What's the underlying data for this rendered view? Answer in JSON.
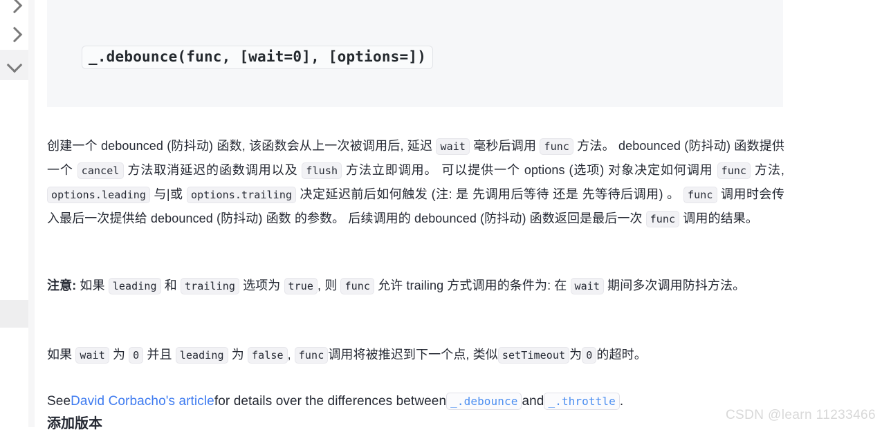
{
  "rail": {
    "items": [
      {
        "name": "chevron-right-icon",
        "glyph": "right",
        "active": false
      },
      {
        "name": "chevron-right-icon",
        "glyph": "right",
        "active": false
      },
      {
        "name": "chevron-down-icon",
        "glyph": "down",
        "active": true
      }
    ]
  },
  "code_block": {
    "signature": "_.debounce(func, [wait=0], [options=])"
  },
  "paragraphs": {
    "p1": {
      "t1": "创建一个 debounced (防抖动) 函数, 该函数会从上一次被调用后, 延迟 ",
      "c1": "wait",
      "t2": " 毫秒后调用 ",
      "c2": "func",
      "t3": " 方法。 debounced (防抖动) 函数提供一个 ",
      "c3": "cancel",
      "t4": " 方法取消延迟的函数调用以及 ",
      "c4": "flush",
      "t5": " 方法立即调用。 可以提供一个 options (选项) 对象决定如何调用 ",
      "c5": "func",
      "t6": " 方法, ",
      "c6": "options.leading",
      "t7": " 与|或 ",
      "c7": "options.trailing",
      "t8": " 决定延迟前后如何触发 (注: 是 先调用后等待 还是 先等待后调用) 。 ",
      "c8": "func",
      "t9": " 调用时会传入最后一次提供给 debounced (防抖动) 函数 的参数。 后续调用的 debounced (防抖动) 函数返回是最后一次 ",
      "c9": "func",
      "t10": " 调用的结果。"
    },
    "p2": {
      "b1": "注意:",
      "t1": " 如果 ",
      "c1": "leading",
      "t2": " 和 ",
      "c2": "trailing",
      "t3": " 选项为 ",
      "c3": "true",
      "t4": ", 则 ",
      "c4": "func",
      "t5": " 允许 trailing 方式调用的条件为: 在 ",
      "c5": "wait",
      "t6": " 期间多次调用防抖方法。"
    },
    "p3": {
      "t1": "如果 ",
      "c1": "wait",
      "t2": " 为 ",
      "c2": "0",
      "t3": " 并且 ",
      "c3": "leading",
      "t4": " 为 ",
      "c4": "false",
      "t5": ", ",
      "c5": "func",
      "t6": "调用将被推迟到下一个点, 类似",
      "c6": "setTimeout",
      "t7": "为",
      "c7": "0",
      "t8": "的超时。"
    },
    "p4": {
      "t1": "See",
      "link": "David Corbacho's article",
      "t2": "for details over the differences between",
      "c1": "_.debounce",
      "t3": "and",
      "c2": "_.throttle",
      "t4": "."
    }
  },
  "heading_1": "添加版本",
  "watermark": "CSDN @learn 11233466",
  "colors": {
    "link": "#3e7bf0",
    "code_link": "#4b8ef1",
    "text": "#252933",
    "code_bg": "#f2f2f5",
    "codeblock_bg": "#f6f7f9",
    "scrollbar_thumb": "#c1c1c1",
    "watermark": "#d8d8d8"
  }
}
